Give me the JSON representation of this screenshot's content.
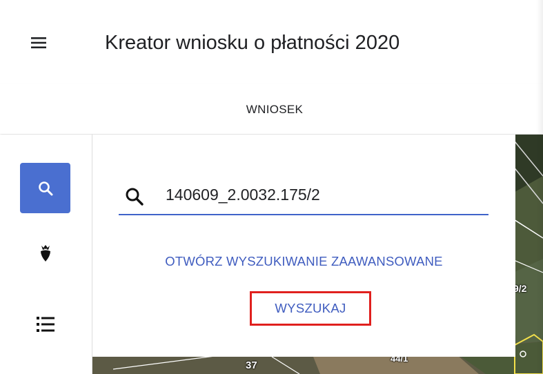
{
  "header": {
    "title": "Kreator wniosku o płatności 2020",
    "menu_icon": "hamburger-menu-icon"
  },
  "tabs": [
    {
      "label": "WNIOSEK"
    }
  ],
  "sidebar": {
    "items": [
      {
        "icon": "search-icon",
        "active": true
      },
      {
        "icon": "beet-crop-icon",
        "active": false
      },
      {
        "icon": "list-icon",
        "active": false
      }
    ]
  },
  "search": {
    "value": "140609_2.0032.175/2",
    "icon": "search-icon"
  },
  "advanced_search_label": "OTWÓRZ WYSZUKIWANIE ZAAWANSOWANE",
  "search_button_label": "WYSZUKAJ",
  "map": {
    "labels": [
      "37",
      "44/1",
      "9/2"
    ]
  },
  "colors": {
    "accent": "#4a6fd0",
    "link": "#3f5cbf",
    "highlight_border": "#e0201e"
  }
}
